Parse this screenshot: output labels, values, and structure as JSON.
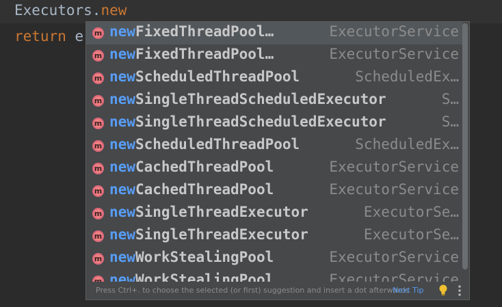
{
  "editor": {
    "line1": {
      "object": "Executors.",
      "method": "new"
    },
    "line2": {
      "keyword": "return",
      "partial": " e"
    }
  },
  "popup": {
    "items": [
      {
        "prefix": "new",
        "rest": "FixedThreadPool…",
        "type": "ExecutorService",
        "selected": true
      },
      {
        "prefix": "new",
        "rest": "FixedThreadPool…",
        "type": "ExecutorService"
      },
      {
        "prefix": "new",
        "rest": "ScheduledThreadPool",
        "type": "ScheduledEx…"
      },
      {
        "prefix": "new",
        "rest": "SingleThreadScheduledExecutor",
        "type": "S…"
      },
      {
        "prefix": "new",
        "rest": "SingleThreadScheduledExecutor",
        "type": "S…"
      },
      {
        "prefix": "new",
        "rest": "ScheduledThreadPool",
        "type": "ScheduledEx…"
      },
      {
        "prefix": "new",
        "rest": "CachedThreadPool",
        "type": "ExecutorService"
      },
      {
        "prefix": "new",
        "rest": "CachedThreadPool",
        "type": "ExecutorService"
      },
      {
        "prefix": "new",
        "rest": "SingleThreadExecutor",
        "type": "ExecutorSe…"
      },
      {
        "prefix": "new",
        "rest": "SingleThreadExecutor",
        "type": "ExecutorSe…"
      },
      {
        "prefix": "new",
        "rest": "WorkStealingPool",
        "type": "ExecutorService"
      },
      {
        "prefix": "new",
        "rest": "WorkStealingPool",
        "type": "ExecutorService"
      }
    ],
    "icon_letter": "m",
    "footer": {
      "hint": "Press Ctrl+. to choose the selected (or first) suggestion and insert a dot afterwards",
      "next_tip": "Next Tip"
    }
  },
  "colors": {
    "background": "#2b2b2b",
    "popup": "#46484a",
    "selected_row": "#52575b",
    "match_prefix": "#589df6",
    "keyword": "#cc7832",
    "method_icon": "#f08080"
  }
}
